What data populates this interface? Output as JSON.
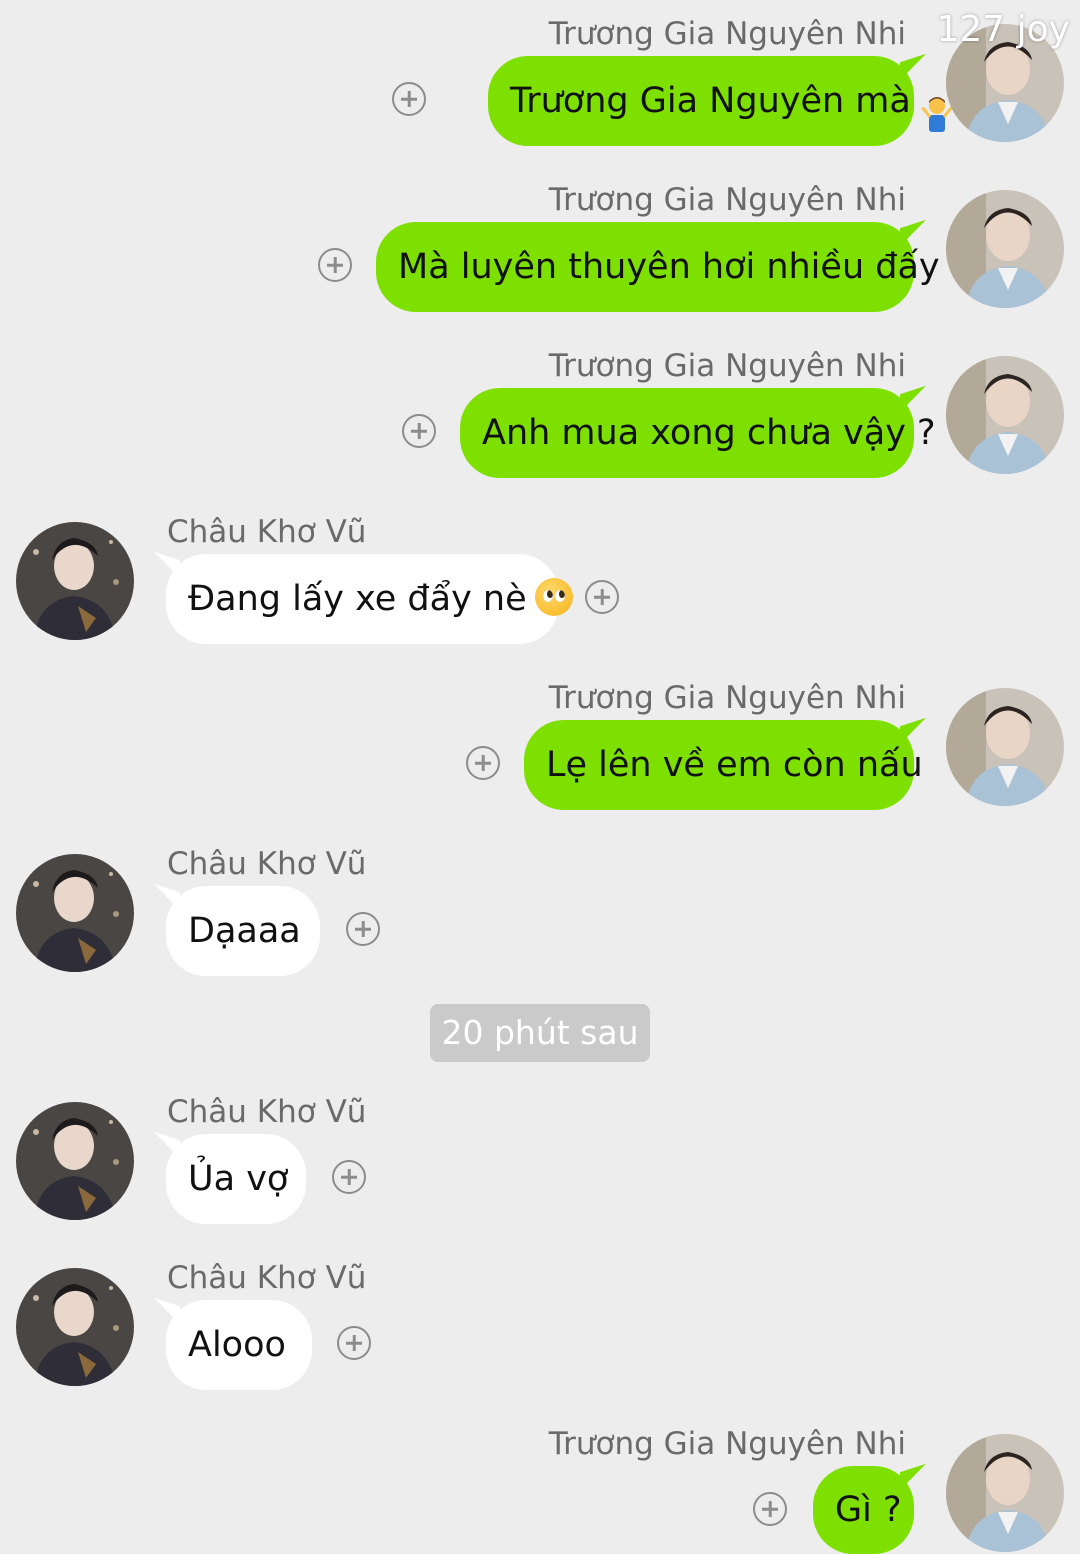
{
  "watermark": "127 joy",
  "separator": "20 phút sau",
  "users": {
    "right_name": "Trương Gia Nguyên Nhi",
    "left_name": "Châu Khơ Vũ"
  },
  "messages": [
    {
      "side": "right",
      "sender": "Trương Gia Nguyên Nhi",
      "text": "Trương Gia Nguyên mà",
      "emoji": "man-shrugging-emoji"
    },
    {
      "side": "right",
      "sender": "Trương Gia Nguyên Nhi",
      "text": "Mà luyên thuyên hơi nhiều đấy"
    },
    {
      "side": "right",
      "sender": "Trương Gia Nguyên Nhi",
      "text": "Anh mua xong chưa vậy ?"
    },
    {
      "side": "left",
      "sender": "Châu Khơ Vũ",
      "text": "Đang lấy xe đẩy nè",
      "emoji": "pleading-face-emoji"
    },
    {
      "side": "right",
      "sender": "Trương Gia Nguyên Nhi",
      "text": "Lẹ lên về em còn nấu"
    },
    {
      "side": "left",
      "sender": "Châu Khơ Vũ",
      "text": "Dạaaa"
    },
    {
      "side": "left",
      "sender": "Châu Khơ Vũ",
      "text": "Ủa vợ"
    },
    {
      "side": "left",
      "sender": "Châu Khơ Vũ",
      "text": "Alooo"
    },
    {
      "side": "right",
      "sender": "Trương Gia Nguyên Nhi",
      "text": "Gì ?"
    }
  ],
  "colors": {
    "background": "#ededed",
    "bubble_right": "#7ee000",
    "bubble_left": "#ffffff",
    "name_text": "#6a6a6a",
    "separator_bg": "#cacaca"
  },
  "icons": {
    "add_reaction": "plus-circle-icon",
    "avatar_right": "avatar-light-suit",
    "avatar_left": "avatar-dark-outfit"
  }
}
